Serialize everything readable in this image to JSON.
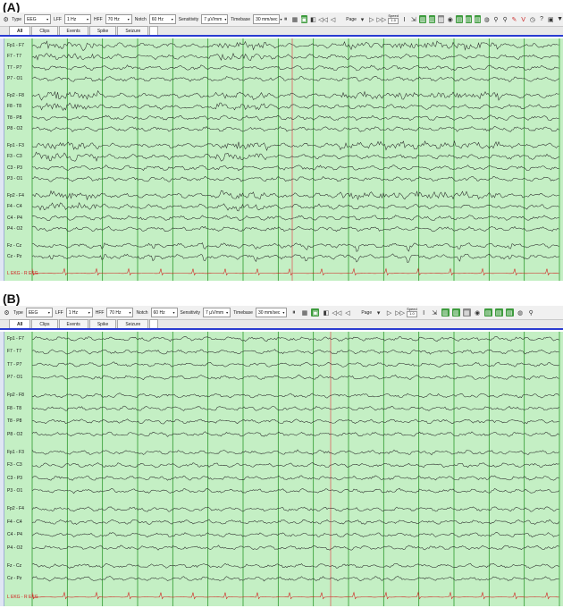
{
  "panels": [
    {
      "label": "(A)",
      "toolbar": {
        "type_label": "Type",
        "type_value": "EEG",
        "lff_label": "LFF",
        "lff_value": "1 Hz",
        "hff_label": "HFF",
        "hff_value": "70 Hz",
        "notch_label": "Notch",
        "notch_value": "60 Hz",
        "sensitivity_label": "Sensitivity",
        "sensitivity_value": "7 µV/mm",
        "timebase_label": "Timebase",
        "timebase_value": "30 mm/sec",
        "page_label": "Page",
        "speed_label": "Speed",
        "speed_value": "1.0"
      },
      "tabs": [
        "All",
        "Clips",
        "Events",
        "Spike",
        "Seizure"
      ],
      "active_tab": "All",
      "artifact": true,
      "seed": 7
    },
    {
      "label": "(B)",
      "toolbar": {
        "type_label": "Type",
        "type_value": "EEG",
        "lff_label": "LFF",
        "lff_value": "1 Hz",
        "hff_label": "HFF",
        "hff_value": "70 Hz",
        "notch_label": "Notch",
        "notch_value": "60 Hz",
        "sensitivity_label": "Sensitivity",
        "sensitivity_value": "7 µV/mm",
        "timebase_label": "Timebase",
        "timebase_value": "30 mm/sec",
        "page_label": "Page",
        "speed_label": "Speed",
        "speed_value": "1.0"
      },
      "tabs": [
        "All",
        "Clips",
        "Events",
        "Spike",
        "Seizure"
      ],
      "active_tab": "All",
      "artifact": false,
      "seed": 13
    }
  ],
  "channels": [
    "Fp1 - F7",
    "F7 - T7",
    "T7 - P7",
    "P7 - O1",
    "Fp2 - F8",
    "F8 - T8",
    "T8 - P8",
    "P8 - O2",
    "Fp1 - F3",
    "F3 - C3",
    "C3 - P3",
    "P3 - O1",
    "Fp2 - F4",
    "F4 - C4",
    "C4 - P4",
    "P4 - O2",
    "Fz - Cz",
    "Cz - Pz",
    "L EKG - R EKG"
  ],
  "colors": {
    "trace_background": "#c4efc4",
    "trace": "#2b2b2b",
    "ekg": "#d21a1a",
    "second_lines": "#2f9a2f",
    "cursor": "#e06060",
    "tab_underline": "#2a3bd1"
  },
  "icons": [
    "rewind-icon",
    "back-icon",
    "play-icon",
    "fast-forward-icon",
    "save-icon",
    "print-icon",
    "zoom-icon",
    "settings-icon"
  ]
}
